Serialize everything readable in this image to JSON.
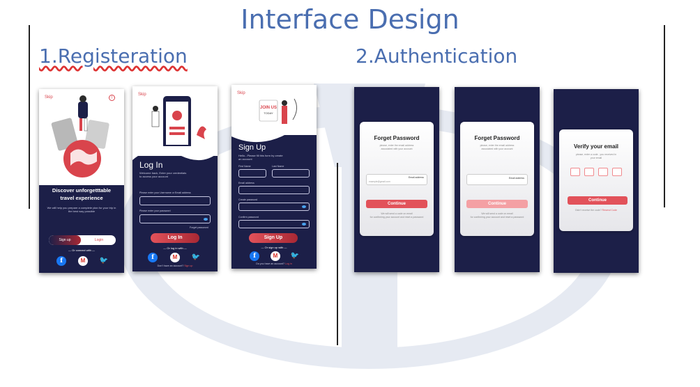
{
  "page": {
    "title": "Interface Design",
    "section1": "1.Registeration",
    "section2": "2.Authentication"
  },
  "colors": {
    "navy": "#1c1f48",
    "accent": "#e2525a",
    "heading": "#4a6eb0"
  },
  "screen1": {
    "skip": "Skip",
    "headline1": "Discover unforgetttable",
    "headline2": "travel experience",
    "desc1": "We will help you prepare a complete plan for your trip in",
    "desc2": "the best way possible",
    "signup": "Sign up",
    "login": "Login",
    "connect": "Or connect with",
    "info_icon": "info-icon"
  },
  "screen2": {
    "skip": "Skip",
    "title": "Log In",
    "sub1": "Welcome back, Enter your credentials",
    "sub2": "to access your account",
    "email_label": "Please enter your Username or Email address",
    "password_label": "Please enter your password",
    "forgot": "Forget password",
    "button": "Log In",
    "or": "Or log in with",
    "no_account": "Don't have an account?",
    "signup_link": "Sign up"
  },
  "screen3": {
    "skip": "Skip",
    "title": "Sign Up",
    "sub1": "Hello...Please fill this form by create",
    "sub2": "an account",
    "first_name": "First Name",
    "last_name": "Last Name",
    "email": "Email address",
    "create_password": "Create password",
    "confirm_password": "Confirm password",
    "button": "Sign Up",
    "or": "Or sign up with",
    "have_account": "Do you have an account?",
    "login_link": "Log in",
    "join_line1": "JOIN US",
    "join_line2": "TODAY"
  },
  "auth1": {
    "title": "Forget Password",
    "sub1": "please, enter the email address",
    "sub2": "associated with your account",
    "field_label": "Email address",
    "placeholder": "example@gmail.com",
    "button": "Continue",
    "note1": "We will send a code on email",
    "note2": "for confirming your account and reset a password"
  },
  "auth2": {
    "title": "Forget Password",
    "sub1": "please, enter the email address",
    "sub2": "associated with your account",
    "field_label": "Email address",
    "button": "Continue",
    "note1": "We will send a code on email",
    "note2": "for confirming your account and reset a password"
  },
  "auth3": {
    "title": "Verify your email",
    "sub1": "please, enter a code , you received in",
    "sub2": "your email",
    "button": "Continue",
    "resend_q": "Didn't receive the code?",
    "resend_link": "Resend Code"
  }
}
